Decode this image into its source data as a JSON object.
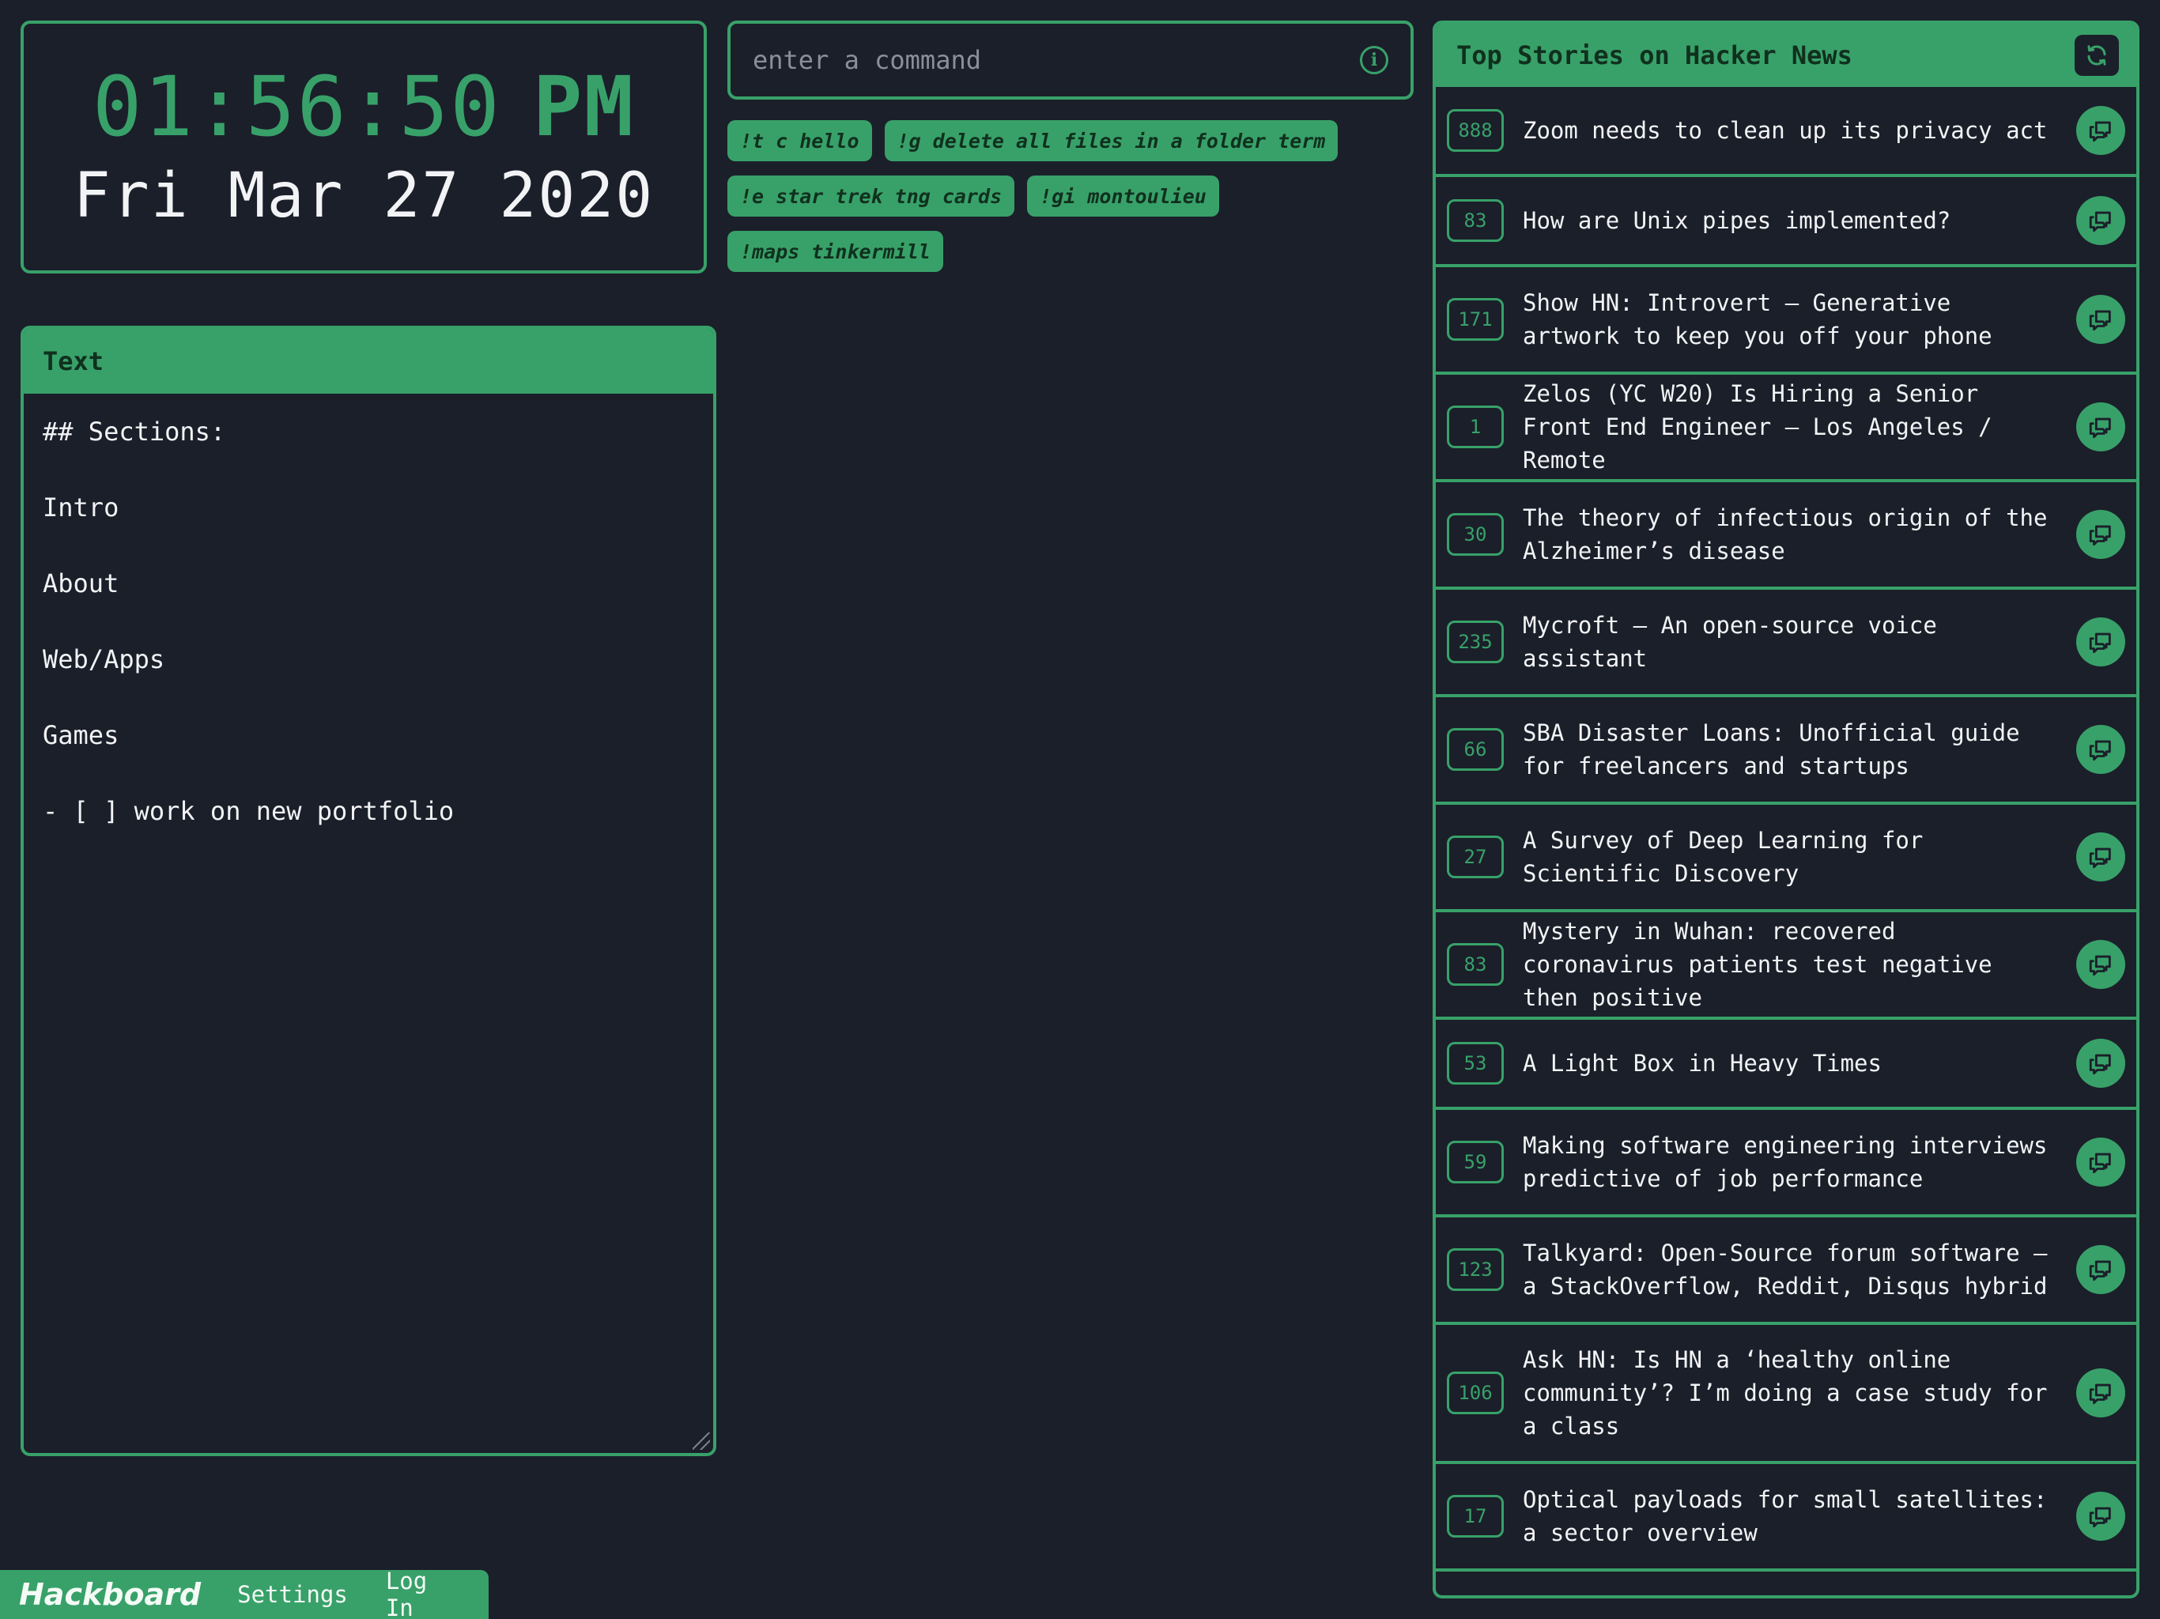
{
  "clock": {
    "time": "01:56:50",
    "ampm": "PM",
    "date": "Fri Mar 27 2020"
  },
  "command": {
    "placeholder": "enter a command",
    "info_icon": "info-icon"
  },
  "chips": [
    "!t c hello",
    "!g delete all files in a folder term",
    "!e star trek tng cards",
    "!gi montoulieu",
    "!maps tinkermill"
  ],
  "text_panel": {
    "title": "Text",
    "lines": [
      "## Sections:",
      "Intro",
      "About",
      "Web/Apps",
      "Games",
      "- [ ] work on new portfolio"
    ]
  },
  "hn": {
    "title": "Top Stories on Hacker News",
    "refresh_icon": "refresh-icon",
    "comment_icon": "comment-icon",
    "stories": [
      {
        "score": "888",
        "title": "Zoom needs to clean up its privacy act"
      },
      {
        "score": "83",
        "title": "How are Unix pipes implemented?"
      },
      {
        "score": "171",
        "title": "Show HN: Introvert – Generative artwork to keep you off your phone"
      },
      {
        "score": "1",
        "title": "Zelos (YC W20) Is Hiring a Senior Front End Engineer – Los Angeles / Remote"
      },
      {
        "score": "30",
        "title": "The theory of infectious origin of the Alzheimer’s disease"
      },
      {
        "score": "235",
        "title": "Mycroft – An open-source voice assistant"
      },
      {
        "score": "66",
        "title": "SBA Disaster Loans: Unofficial guide for freelancers and startups"
      },
      {
        "score": "27",
        "title": "A Survey of Deep Learning for Scientific Discovery"
      },
      {
        "score": "83",
        "title": "Mystery in Wuhan: recovered coronavirus patients test negative then positive"
      },
      {
        "score": "53",
        "title": "A Light Box in Heavy Times"
      },
      {
        "score": "59",
        "title": "Making software engineering interviews predictive of job performance"
      },
      {
        "score": "123",
        "title": "Talkyard: Open-Source forum software – a StackOverflow, Reddit, Disqus hybrid"
      },
      {
        "score": "106",
        "title": "Ask HN: Is HN a ‘healthy online community’? I’m doing a case study for a class"
      },
      {
        "score": "17",
        "title": "Optical payloads for small satellites: a sector overview"
      }
    ]
  },
  "bottom_bar": {
    "brand": "Hackboard",
    "settings": "Settings",
    "login": "Log In"
  },
  "colors": {
    "accent": "#38a169",
    "background": "#1b1f2a",
    "text": "#f2f3f5"
  }
}
